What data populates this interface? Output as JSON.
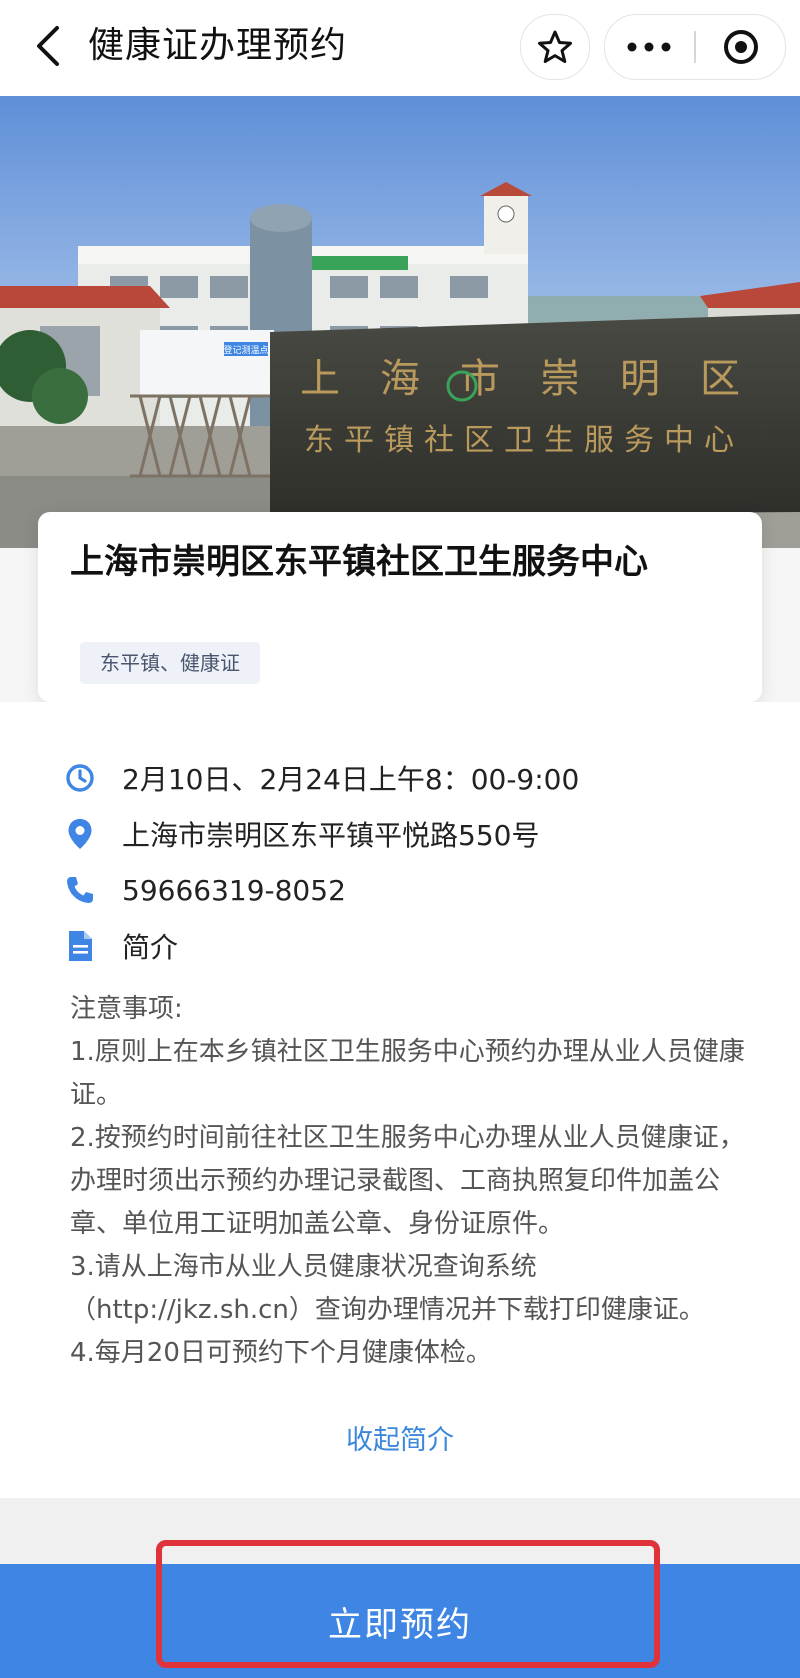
{
  "nav": {
    "title": "健康证办理预约",
    "icons": {
      "back": "chevron-left-icon",
      "star": "star-icon",
      "more": "more-dots-icon",
      "close": "target-close-icon"
    }
  },
  "hero": {
    "wall_text_line1": "上海市崇明区",
    "wall_text_line2": "东平镇社区卫生服务中心",
    "sign_text": "登记测温点"
  },
  "card": {
    "name": "上海市崇明区东平镇社区卫生服务中心",
    "tag": "东平镇、健康证"
  },
  "details": {
    "time": "2月10日、2月24日上午8：00-9:00",
    "address": "上海市崇明区东平镇平悦路550号",
    "phone": "59666319-8052",
    "intro_label": "简介",
    "notes_title": "注意事项:",
    "notes": [
      "1.原则上在本乡镇社区卫生服务中心预约办理从业人员健康证。",
      "2.按预约时间前往社区卫生服务中心办理从业人员健康证，办理时须出示预约办理记录截图、工商执照复印件加盖公章、单位用工证明加盖公章、身份证原件。",
      "3.请从上海市从业人员健康状况查询系统（http://jkz.sh.cn）查询办理情况并下载打印健康证。",
      "4.每月20日可预约下个月健康体检。"
    ],
    "collapse_label": "收起简介"
  },
  "footer": {
    "reserve_label": "立即预约"
  },
  "colors": {
    "accent": "#3f86e4",
    "link": "#3b87db",
    "highlight": "#e0323a"
  }
}
